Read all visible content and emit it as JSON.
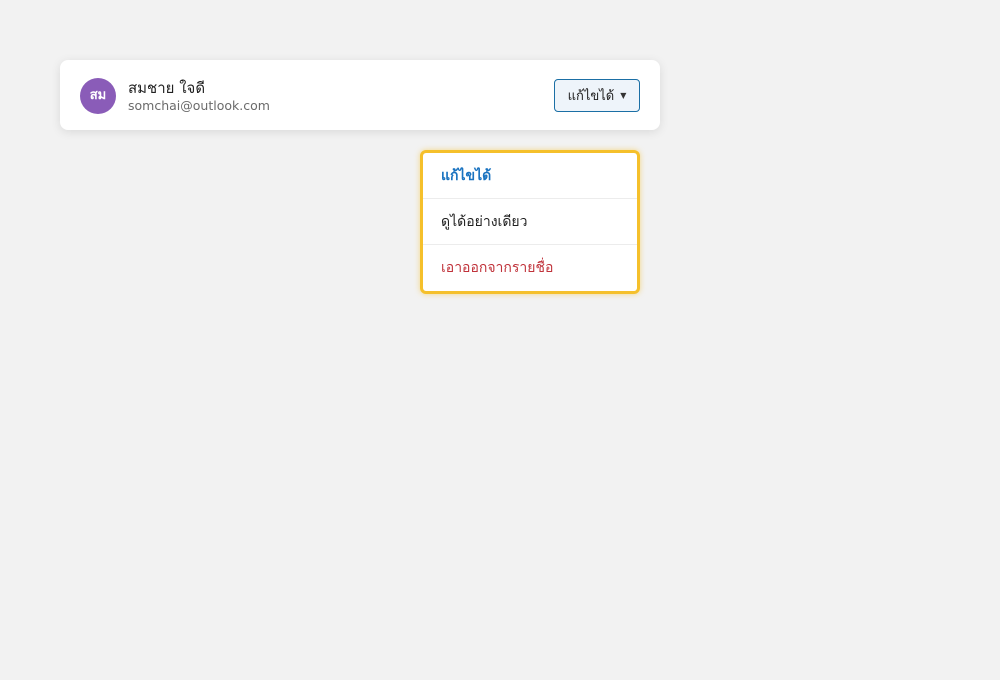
{
  "user": {
    "avatar_initials": "สม",
    "avatar_color": "#8a5cb8",
    "name": "สมชาย ใจดี",
    "email": "somchai@outlook.com"
  },
  "permission_button": {
    "label": "แก้ไขได้",
    "icon": "caret-down-icon"
  },
  "permission_menu": {
    "items": [
      {
        "label": "แก้ไขได้",
        "selected": true,
        "color": "#1a73c0"
      },
      {
        "label": "ดูได้อย่างเดียว",
        "selected": false,
        "color": "#1f1f1f"
      },
      {
        "label": "เอาออกจากรายชื่อ",
        "selected": false,
        "color": "#c0323a"
      }
    ]
  },
  "colors": {
    "background": "#f2f2f2",
    "accent": "#1b6fa5",
    "focus_ring": "#f5c02b"
  }
}
